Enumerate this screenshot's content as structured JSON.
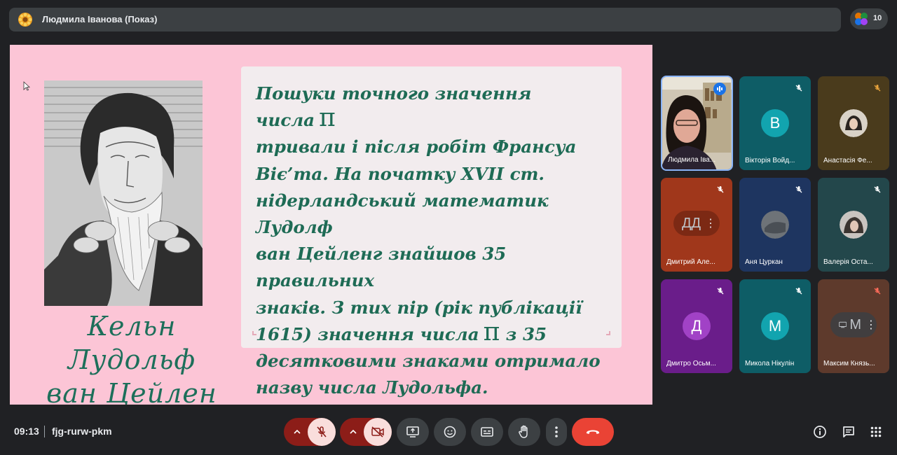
{
  "presenter_bar": {
    "title": "Людмила Іванова (Показ)"
  },
  "participants_button": {
    "count": "10"
  },
  "slide": {
    "caption_line1": "Кельн Лудольф",
    "caption_line2": "ван Цейлен",
    "lines": [
      "Пошуки точного значення числа",
      "тривали і після робіт Франсуа",
      "Віє’та. На початку XVII ст.",
      "нідерландський математик Лудолф",
      "ван Цейленг знайшов 35 правильних",
      "знаків. З тих пір (рік публікації",
      "1615) значення числа",
      "з 35",
      "десятковими знаками отримало",
      "назву числа Лудольфа."
    ],
    "pi_symbol": "π"
  },
  "tiles": [
    {
      "name": "Людмила Іва...",
      "initial": "",
      "kind": "video"
    },
    {
      "name": "Вікторія Войд...",
      "initial": "В",
      "kind": "letter",
      "avatar_color": "#12a4af",
      "bg": "#0e5d66"
    },
    {
      "name": "Анастасія Фе...",
      "initial": "",
      "kind": "photo",
      "bg": "#4a3b1c"
    },
    {
      "name": "Дмитрий Але...",
      "initial": "ДД",
      "kind": "pill",
      "bg": "#a0371b"
    },
    {
      "name": "Аня Цуркан",
      "initial": "",
      "kind": "photo",
      "bg": "#1e3560"
    },
    {
      "name": "Валерія Оста...",
      "initial": "",
      "kind": "photo",
      "bg": "#23474b"
    },
    {
      "name": "Дмитро Осьм...",
      "initial": "Д",
      "kind": "letter",
      "avatar_color": "#a142c6",
      "bg": "#6a1d8a"
    },
    {
      "name": "Микола Нікулін",
      "initial": "М",
      "kind": "letter",
      "avatar_color": "#12a4af",
      "bg": "#0e5d66"
    },
    {
      "name": "Максим Князь...",
      "initial": "М",
      "kind": "pill",
      "bg": "#5e3a2c"
    }
  ],
  "bottom_bar": {
    "time": "09:13",
    "meeting_code": "fjg-rurw-pkm"
  },
  "colors": {
    "slide_bg": "#fcc5d6",
    "slide_text": "#1e6b55",
    "end_call": "#ea4335",
    "muted": "#f9dedc"
  }
}
